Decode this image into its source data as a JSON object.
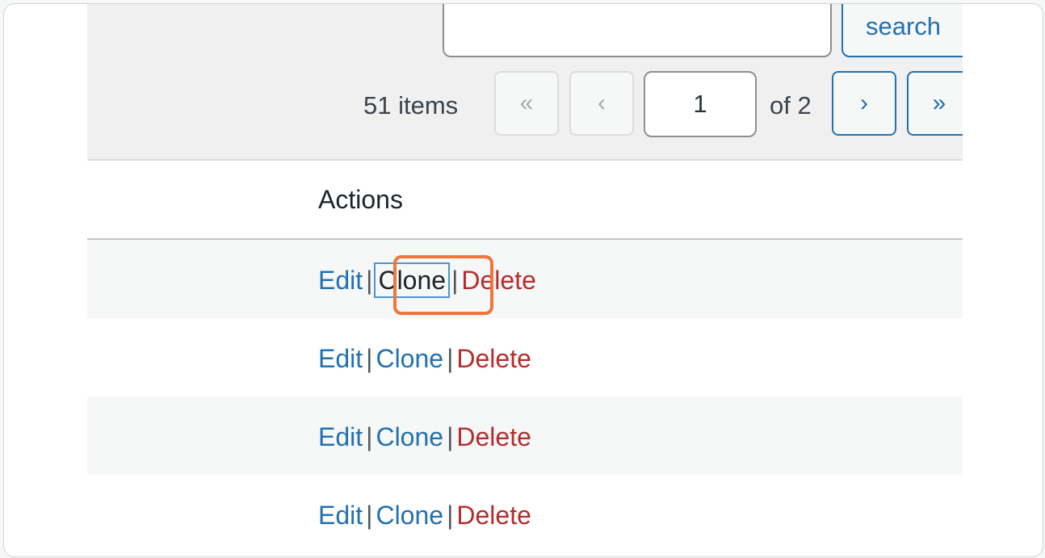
{
  "search": {
    "button_label": "search",
    "input_value": ""
  },
  "pagination": {
    "items_count": "51 items",
    "first_label": "«",
    "prev_label": "‹",
    "current_page": "1",
    "of_pages": "of 2",
    "next_label": "›",
    "last_label": "»"
  },
  "table": {
    "column_header": "Actions",
    "rows": [
      {
        "edit": "Edit",
        "clone": "Clone",
        "delete": "Delete",
        "sep": "|"
      },
      {
        "edit": "Edit",
        "clone": "Clone",
        "delete": "Delete",
        "sep": "|"
      },
      {
        "edit": "Edit",
        "clone": "Clone",
        "delete": "Delete",
        "sep": "|"
      },
      {
        "edit": "Edit",
        "clone": "Clone",
        "delete": "Delete",
        "sep": "|"
      }
    ]
  },
  "colors": {
    "link": "#2271b1",
    "delete": "#b32d2e",
    "highlight": "#f0763e"
  }
}
